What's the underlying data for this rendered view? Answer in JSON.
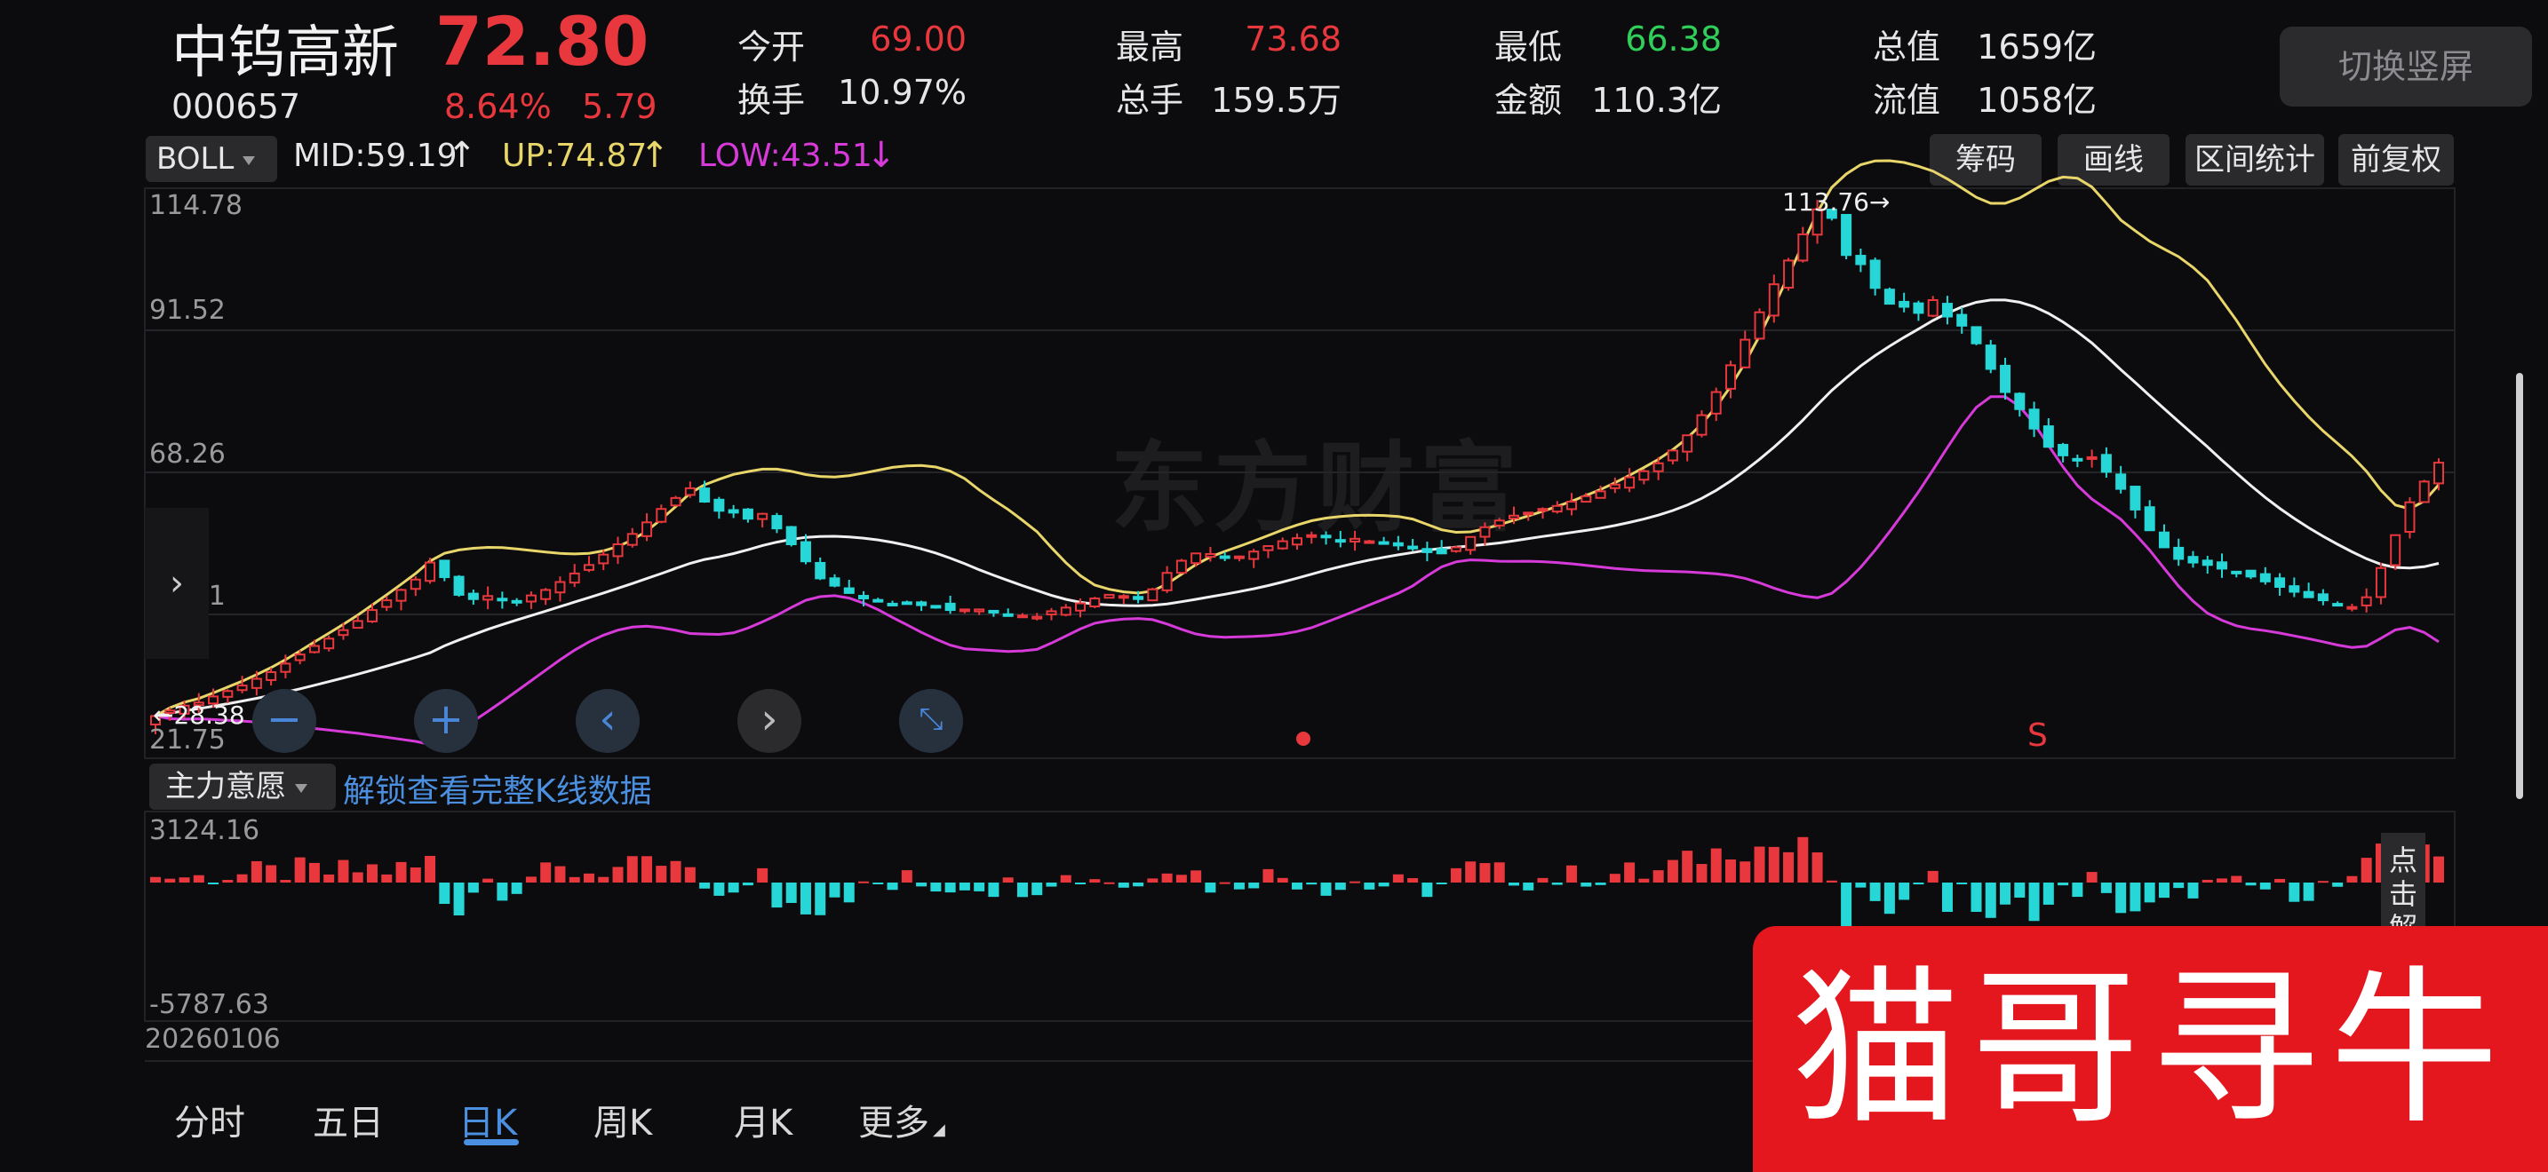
{
  "header": {
    "stock_name": "中钨高新",
    "price": "72.80",
    "code": "000657",
    "change_pct": "8.64%",
    "change_amt": "5.79",
    "quotes": [
      {
        "label": "今开",
        "value": "69.00",
        "color": "#e8383d"
      },
      {
        "label": "最高",
        "value": "73.68",
        "color": "#e8383d"
      },
      {
        "label": "最低",
        "value": "66.38",
        "color": "#2fcf5a"
      },
      {
        "label": "总值",
        "value": "1659亿",
        "color": "#e6e6e6"
      },
      {
        "label": "换手",
        "value": "10.97%",
        "color": "#e6e6e6"
      },
      {
        "label": "总手",
        "value": "159.5万",
        "color": "#e6e6e6"
      },
      {
        "label": "金额",
        "value": "110.3亿",
        "color": "#e6e6e6"
      },
      {
        "label": "流值",
        "value": "1058亿",
        "color": "#e6e6e6"
      }
    ],
    "switch_label": "切换竖屏"
  },
  "toolbar": {
    "indicator": "BOLL",
    "mid": "MID:59.19",
    "up": "UP:74.87",
    "low": "LOW:43.51",
    "buttons": [
      "筹码",
      "画线",
      "区间统计",
      "前复权"
    ]
  },
  "main_chart": {
    "y_labels": [
      "114.78",
      "91.52",
      "68.26",
      "45.01",
      "21.75"
    ],
    "high_marker": "113.76",
    "low_marker": "28.38",
    "watermark": "东方财富",
    "signal": "S",
    "colors": {
      "up": "#e8383d",
      "down": "#27d6d6",
      "mid": "#f0f0f0",
      "upper": "#e8d66a",
      "lower": "#d63ad9"
    }
  },
  "sub_chart": {
    "indicator": "主力意愿",
    "unlock_text": "解锁查看完整K线数据",
    "y_max": "3124.16",
    "y_min": "-5787.63",
    "date": "20260106",
    "side_label": "点击解"
  },
  "tabs": [
    {
      "label": "分时",
      "active": false
    },
    {
      "label": "五日",
      "active": false
    },
    {
      "label": "日K",
      "active": true
    },
    {
      "label": "周K",
      "active": false
    },
    {
      "label": "月K",
      "active": false
    },
    {
      "label": "更多",
      "active": false
    }
  ],
  "banner": {
    "text": "猫哥寻牛"
  },
  "icons": [
    "zoom-out-icon",
    "zoom-in-icon",
    "left-arrow-icon",
    "right-arrow-icon",
    "collapse-icon"
  ],
  "chart_data": {
    "type": "candlestick",
    "ylim": [
      21.75,
      114.78
    ],
    "closes": [
      28.4,
      29.3,
      30.1,
      30.6,
      31.6,
      32.5,
      33.4,
      34.5,
      35.6,
      37.0,
      38.5,
      39.9,
      41.1,
      42.5,
      44.0,
      45.8,
      47.4,
      49.1,
      50.8,
      53.6,
      51.2,
      48.3,
      47.6,
      48.1,
      47.5,
      47.2,
      48.2,
      49.1,
      50.4,
      51.8,
      53.2,
      54.9,
      56.6,
      58.3,
      60.2,
      62.4,
      64.2,
      65.8,
      63.6,
      62.1,
      61.8,
      60.8,
      61.6,
      59.2,
      56.6,
      53.8,
      51.0,
      49.8,
      48.6,
      47.7,
      47.3,
      46.7,
      47.0,
      46.6,
      46.4,
      45.8,
      45.9,
      45.9,
      45.5,
      45.1,
      44.9,
      44.7,
      45.6,
      46.2,
      46.9,
      47.7,
      48.3,
      48.1,
      47.6,
      49.2,
      51.9,
      53.9,
      55.1,
      55.0,
      54.4,
      54.6,
      55.4,
      56.3,
      57.1,
      57.6,
      58.1,
      57.8,
      57.3,
      57.5,
      57.1,
      56.8,
      56.4,
      55.9,
      55.3,
      55.1,
      56.1,
      57.8,
      59.4,
      60.5,
      61.3,
      61.8,
      62.4,
      62.9,
      63.6,
      64.5,
      65.3,
      66.4,
      67.6,
      68.6,
      69.9,
      72.0,
      74.5,
      77.8,
      81.6,
      86.0,
      90.2,
      94.7,
      99.3,
      103.2,
      107.5,
      111.6,
      110.2,
      104.1,
      102.6,
      98.7,
      96.1,
      95.6,
      94.6,
      96.7,
      94.0,
      92.5,
      89.6,
      85.4,
      81.6,
      78.8,
      75.6,
      72.6,
      71.2,
      70.6,
      70.9,
      68.5,
      65.7,
      62.3,
      58.9,
      56.1,
      54.2,
      53.6,
      53.2,
      52.6,
      52.0,
      51.3,
      50.5,
      49.6,
      48.8,
      47.9,
      47.4,
      46.8,
      46.3,
      47.9,
      52.7,
      58.1,
      63.5,
      66.9,
      70.0
    ]
  }
}
